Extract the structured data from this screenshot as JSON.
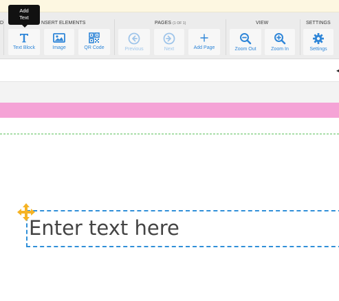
{
  "tooltip": {
    "text_line1": "Add",
    "text_line2": "Text"
  },
  "toolbar": {
    "groups": {
      "left_cut": "D",
      "insert": "NSERT ELEMENTS",
      "pages": "PAGES",
      "pages_count": "(1 OF 1)",
      "view": "VIEW",
      "settings": "SETTINGS"
    },
    "buttons": {
      "text_block": "Text Block",
      "image": "Image",
      "qr_code": "QR Code",
      "previous": "Previous",
      "next": "Next",
      "add_page": "Add Page",
      "zoom_out": "Zoom Out",
      "zoom_in": "Zoom In",
      "settings": "Settings"
    }
  },
  "canvas": {
    "text_placeholder": "Enter text here",
    "band_glyph": "◂"
  },
  "colors": {
    "accent_blue": "#2f86d8",
    "pink_band": "#f5a3d6",
    "guide_green": "#5cc15c",
    "handle_orange": "#f5b324"
  }
}
